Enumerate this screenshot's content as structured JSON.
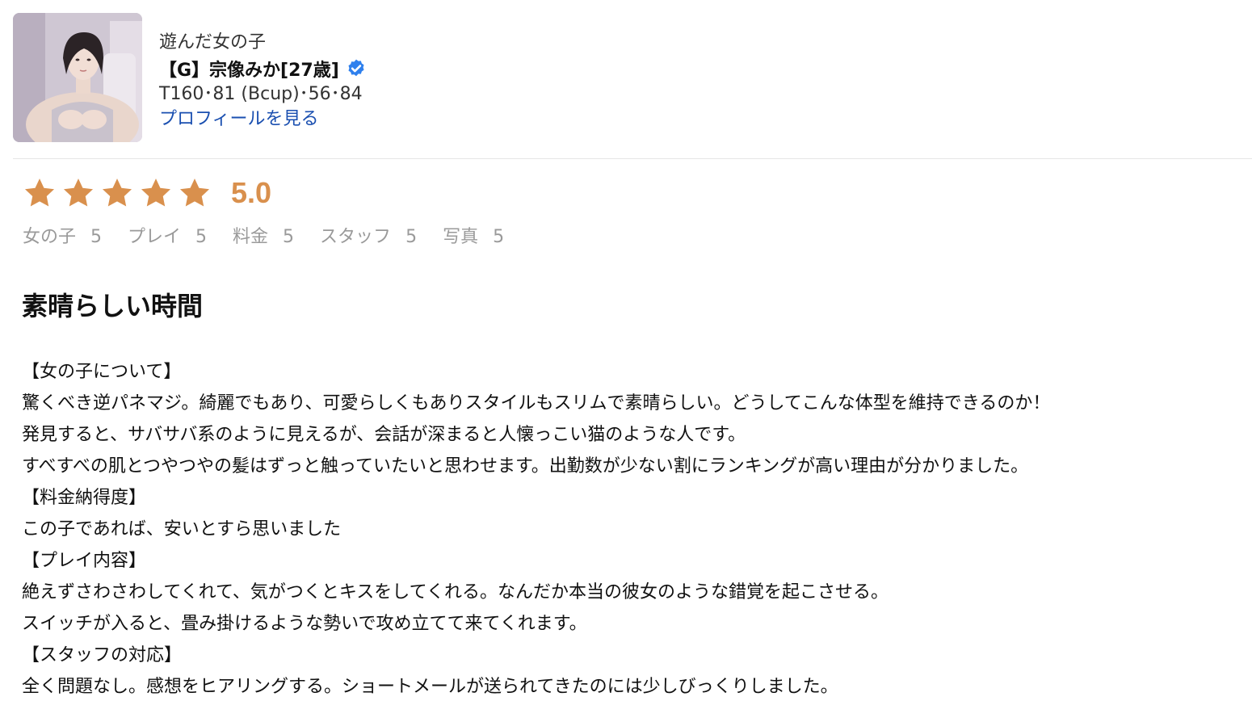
{
  "profile": {
    "visited_label": "遊んだ女の子",
    "name": "【G】宗像みか[27歳]",
    "verified_icon": "verified-check-icon",
    "measurements": "T160･81 (Bcup)･56･84",
    "profile_link": "プロフィールを見る"
  },
  "rating": {
    "stars": 5,
    "max_stars": 5,
    "value": "5.0",
    "star_color": "#d9904d"
  },
  "subratings": [
    {
      "label": "女の子",
      "value": "5"
    },
    {
      "label": "プレイ",
      "value": "5"
    },
    {
      "label": "料金",
      "value": "5"
    },
    {
      "label": "スタッフ",
      "value": "5"
    },
    {
      "label": "写真",
      "value": "5"
    }
  ],
  "review": {
    "title": "素晴らしい時間",
    "lines": [
      "【女の子について】",
      "驚くべき逆パネマジ。綺麗でもあり、可愛らしくもありスタイルもスリムで素晴らしい。どうしてこんな体型を維持できるのか！",
      "発見すると、サバサバ系のように見えるが、会話が深まると人懐っこい猫のような人です。",
      "すべすべの肌とつやつやの髪はずっと触っていたいと思わせます。出勤数が少ない割にランキングが高い理由が分かりました。",
      "【料金納得度】",
      "この子であれば、安いとすら思いました",
      "【プレイ内容】",
      "絶えずさわさわしてくれて、気がつくとキスをしてくれる。なんだか本当の彼女のような錯覚を起こさせる。",
      "スイッチが入ると、畳み掛けるような勢いで攻め立てて来てくれます。",
      "【スタッフの対応】",
      "全く問題なし。感想をヒアリングする。ショートメールが送られてきたのには少しびっくりしました。"
    ]
  },
  "colors": {
    "accent_star": "#d9904d",
    "link": "#1a4fb0",
    "verified": "#2f80ed",
    "muted_text": "#9a9a9a"
  }
}
